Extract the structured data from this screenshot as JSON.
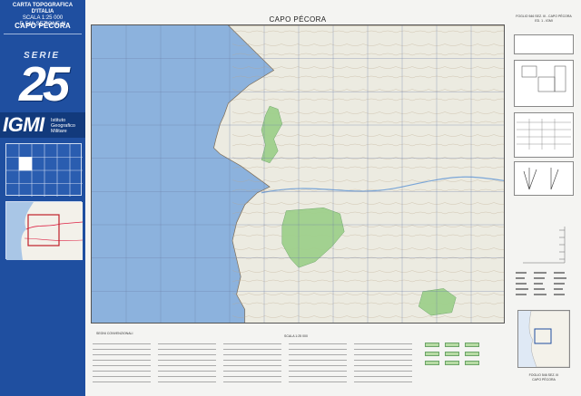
{
  "cover": {
    "header_lines": [
      "CARTA TOPOGRAFICA D'ITALIA",
      "SCALA 1:25 000",
      "F. 546 SEZIONE III"
    ],
    "sheet_name": "CAPO PÉCORA",
    "series_label": "SERIE",
    "series_number": "25",
    "institute_logo": "IGMI",
    "institute_name": [
      "Istituto",
      "Geografico",
      "Militare"
    ],
    "colors": {
      "panel": "#1f4fa0",
      "panel_dark": "#123a7c",
      "text": "#ffffff"
    }
  },
  "map": {
    "title": "CAPO PÉCORA",
    "colors": {
      "sea": "#8cb2dd",
      "land": "#ecebe1",
      "vegetation": "#9fd08c",
      "grid": "#6d7ea8",
      "contour": "#b9a58a"
    },
    "land_polygon": [
      [
        0.33,
        0
      ],
      [
        1,
        0
      ],
      [
        1,
        1
      ],
      [
        0.37,
        1
      ],
      [
        0.37,
        0.95
      ],
      [
        0.35,
        0.9
      ],
      [
        0.36,
        0.84
      ],
      [
        0.35,
        0.78
      ],
      [
        0.34,
        0.72
      ],
      [
        0.35,
        0.66
      ],
      [
        0.37,
        0.6
      ],
      [
        0.4,
        0.56
      ],
      [
        0.43,
        0.54
      ],
      [
        0.36,
        0.47
      ],
      [
        0.31,
        0.43
      ],
      [
        0.295,
        0.41
      ],
      [
        0.3,
        0.38
      ],
      [
        0.31,
        0.33
      ],
      [
        0.32,
        0.3
      ],
      [
        0.33,
        0.26
      ],
      [
        0.38,
        0.2
      ],
      [
        0.44,
        0.15
      ]
    ],
    "vegetation_polygons": [
      [
        [
          0.43,
          0.27
        ],
        [
          0.45,
          0.28
        ],
        [
          0.46,
          0.33
        ],
        [
          0.44,
          0.38
        ],
        [
          0.45,
          0.42
        ],
        [
          0.43,
          0.46
        ],
        [
          0.41,
          0.45
        ],
        [
          0.42,
          0.4
        ],
        [
          0.41,
          0.35
        ],
        [
          0.42,
          0.3
        ]
      ],
      [
        [
          0.47,
          0.62
        ],
        [
          0.56,
          0.61
        ],
        [
          0.6,
          0.63
        ],
        [
          0.61,
          0.69
        ],
        [
          0.58,
          0.74
        ],
        [
          0.54,
          0.79
        ],
        [
          0.5,
          0.81
        ],
        [
          0.48,
          0.78
        ],
        [
          0.46,
          0.73
        ],
        [
          0.46,
          0.67
        ]
      ],
      [
        [
          0.8,
          0.89
        ],
        [
          0.85,
          0.88
        ],
        [
          0.88,
          0.91
        ],
        [
          0.87,
          0.96
        ],
        [
          0.82,
          0.97
        ],
        [
          0.79,
          0.94
        ]
      ]
    ]
  },
  "sidepanel": {
    "header_lines": [
      "FOGLIO 546 SEZ. III - CAPO PÉCORA",
      "ED. 1 - IGMI"
    ],
    "footer_lines": [
      "FOGLIO 546 SEZ. III",
      "CAPO PÉCORA"
    ]
  },
  "legend": {
    "heading": "SEGNI CONVENZIONALI",
    "center_text": "SCALA 1:25 000"
  }
}
